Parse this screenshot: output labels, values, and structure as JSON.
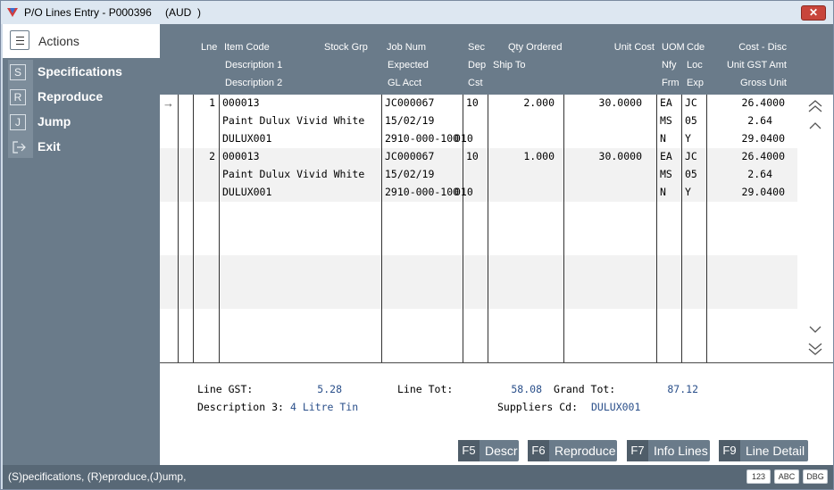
{
  "window": {
    "title": "P/O Lines Entry - P000396",
    "currency": "(AUD  )",
    "close_label": "✕"
  },
  "sidebar": {
    "header": "Actions",
    "items": [
      {
        "key": "S",
        "label": "Specifications"
      },
      {
        "key": "R",
        "label": "Reproduce"
      },
      {
        "key": "J",
        "label": "Jump"
      },
      {
        "key": "",
        "label": "Exit"
      }
    ]
  },
  "grid": {
    "headers": {
      "row1": {
        "lne": "Lne",
        "item_code": "Item Code",
        "stock_grp": "Stock Grp",
        "job_num": "Job Num",
        "sec": "Sec",
        "qty_ordered": "Qty Ordered",
        "unit_cost": "Unit Cost",
        "uom": "UOM",
        "cde": "Cde",
        "cost_disc": "Cost - Disc"
      },
      "row2": {
        "desc1": "Description 1",
        "expected": "Expected",
        "dep": "Dep",
        "ship_to": "Ship To",
        "nfy": "Nfy",
        "loc": "Loc",
        "unit_gst": "Unit GST Amt"
      },
      "row3": {
        "desc2": "Description 2",
        "gl_acct": "GL Acct",
        "cst": "Cst",
        "frm": "Frm",
        "exp": "Exp",
        "gross_unit": "Gross Unit"
      }
    },
    "rows": [
      {
        "lne": "1",
        "item_code": "000013",
        "description1": "Paint Dulux Vivid White",
        "description2": "DULUX001",
        "job_num": "JC000067",
        "expected": "15/02/19",
        "gl_acct": "2910-000-100",
        "sec": "10",
        "dep": "",
        "cst": "010",
        "qty_ordered": "2.000",
        "unit_cost": "30.0000",
        "uom": "EA",
        "nfy": "MS",
        "frm": "N",
        "cde": "JC",
        "loc": "05",
        "exp": "Y",
        "cost_disc": "26.4000",
        "unit_gst": "2.64",
        "gross_unit": "29.0400"
      },
      {
        "lne": "2",
        "item_code": "000013",
        "description1": "Paint Dulux Vivid White",
        "description2": "DULUX001",
        "job_num": "JC000067",
        "expected": "15/02/19",
        "gl_acct": "2910-000-100",
        "sec": "10",
        "dep": "",
        "cst": "010",
        "qty_ordered": "1.000",
        "unit_cost": "30.0000",
        "uom": "EA",
        "nfy": "MS",
        "frm": "N",
        "cde": "JC",
        "loc": "05",
        "exp": "Y",
        "cost_disc": "26.4000",
        "unit_gst": "2.64",
        "gross_unit": "29.0400"
      }
    ],
    "current_row_marker": "→"
  },
  "summary": {
    "line_gst_label": "Line GST:",
    "line_gst": "5.28",
    "line_tot_label": "Line Tot:",
    "line_tot": "58.08",
    "grand_tot_label": "Grand Tot:",
    "grand_tot": "87.12",
    "desc3_label": "Description 3:",
    "desc3": "4 Litre Tin",
    "suppliers_cd_label": "Suppliers Cd:",
    "suppliers_cd": "DULUX001"
  },
  "function_keys": [
    {
      "key": "F5",
      "label": "Descr"
    },
    {
      "key": "F6",
      "label": "Reproduce"
    },
    {
      "key": "F7",
      "label": "Info Lines"
    },
    {
      "key": "F9",
      "label": "Line Detail"
    }
  ],
  "statusbar": {
    "text": "(S)pecifications, (R)eproduce,(J)ump,",
    "badges": [
      "123",
      "ABC",
      "DBG"
    ]
  },
  "colors": {
    "header_bg": "#6a7b8a",
    "value_blue": "#2a4f8a",
    "close_red": "#c8453b"
  }
}
